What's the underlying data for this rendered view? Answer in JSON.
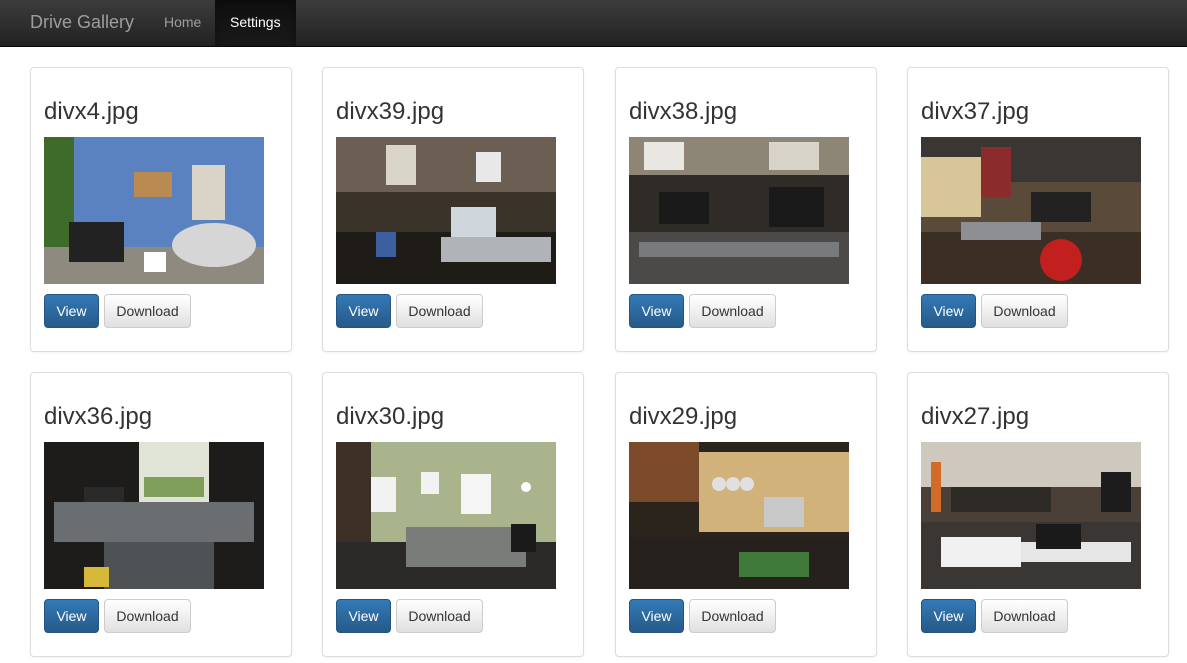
{
  "navbar": {
    "brand": "Drive Gallery",
    "links": [
      {
        "label": "Home",
        "active": false
      },
      {
        "label": "Settings",
        "active": true
      }
    ]
  },
  "gallery": {
    "items": [
      {
        "title": "divx4.jpg",
        "view_label": "View",
        "download_label": "Download"
      },
      {
        "title": "divx39.jpg",
        "view_label": "View",
        "download_label": "Download"
      },
      {
        "title": "divx38.jpg",
        "view_label": "View",
        "download_label": "Download"
      },
      {
        "title": "divx37.jpg",
        "view_label": "View",
        "download_label": "Download"
      },
      {
        "title": "divx36.jpg",
        "view_label": "View",
        "download_label": "Download"
      },
      {
        "title": "divx30.jpg",
        "view_label": "View",
        "download_label": "Download"
      },
      {
        "title": "divx29.jpg",
        "view_label": "View",
        "download_label": "Download"
      },
      {
        "title": "divx27.jpg",
        "view_label": "View",
        "download_label": "Download"
      }
    ]
  }
}
